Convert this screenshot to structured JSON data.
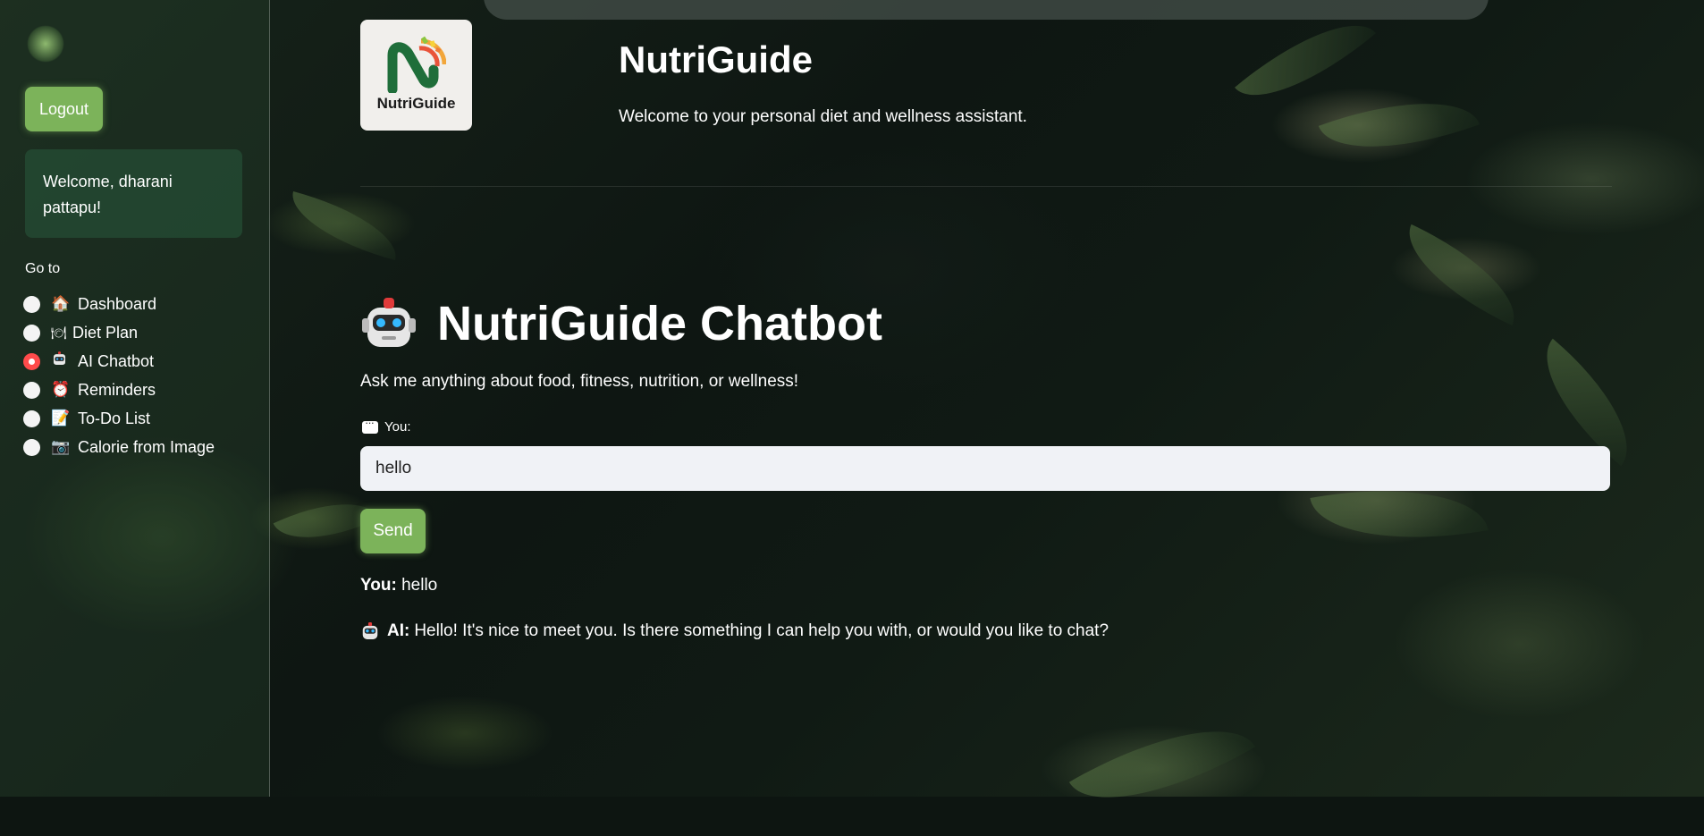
{
  "sidebar": {
    "logout_label": "Logout",
    "welcome_text": "Welcome, dharani pattapu!",
    "goto_label": "Go to",
    "nav_items": [
      {
        "icon": "house-icon",
        "glyph": "🏠",
        "label": "Dashboard",
        "selected": false
      },
      {
        "icon": "plate-icon",
        "glyph": "🍽",
        "label": "Diet Plan",
        "selected": false
      },
      {
        "icon": "robot-icon",
        "glyph": "",
        "label": "AI Chatbot",
        "selected": true
      },
      {
        "icon": "alarm-clock-icon",
        "glyph": "⏰",
        "label": "Reminders",
        "selected": false
      },
      {
        "icon": "memo-icon",
        "glyph": "📝",
        "label": "To-Do List",
        "selected": false
      },
      {
        "icon": "camera-icon",
        "glyph": "📷",
        "label": "Calorie from Image",
        "selected": false
      }
    ]
  },
  "header": {
    "logo_text": "NutriGuide",
    "title": "NutriGuide",
    "subtitle": "Welcome to your personal diet and wellness assistant."
  },
  "chat": {
    "title": "NutriGuide Chatbot",
    "description": "Ask me anything about food, fitness, nutrition, or wellness!",
    "input_label": "You:",
    "input_value": "hello",
    "send_label": "Send",
    "messages": [
      {
        "speaker": "You:",
        "text": "hello"
      },
      {
        "speaker": "AI:",
        "text": "Hello! It's nice to meet you. Is there something I can help you with, or would you like to chat?"
      }
    ]
  },
  "colors": {
    "accent": "#7cb35a",
    "radio_selected": "#ff4b4b",
    "input_bg": "#f0f2f6"
  }
}
